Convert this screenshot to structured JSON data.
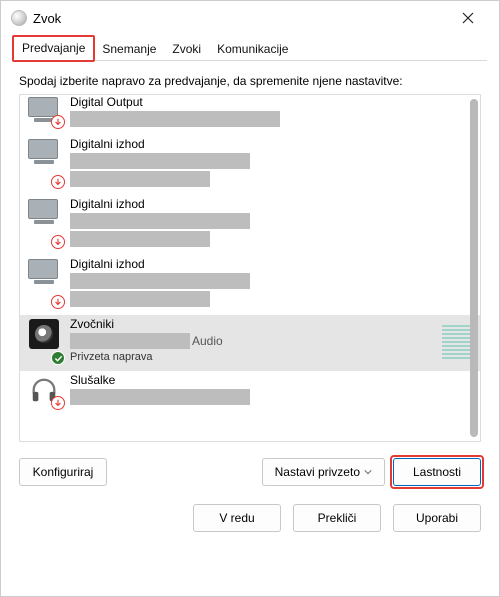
{
  "window": {
    "title": "Zvok"
  },
  "tabs": [
    {
      "label": "Predvajanje",
      "active": true
    },
    {
      "label": "Snemanje",
      "active": false
    },
    {
      "label": "Zvoki",
      "active": false
    },
    {
      "label": "Komunikacije",
      "active": false
    }
  ],
  "instruction": "Spodaj izberite napravo za predvajanje, da spremenite njene nastavitve:",
  "devices": [
    {
      "name": "Digital Output",
      "icon": "monitor",
      "status_badge": "down",
      "truncated_top": true
    },
    {
      "name": "Digitalni izhod",
      "icon": "monitor",
      "status_badge": "down"
    },
    {
      "name": "Digitalni izhod",
      "icon": "monitor",
      "status_badge": "down"
    },
    {
      "name": "Digitalni izhod",
      "icon": "monitor",
      "status_badge": "down"
    },
    {
      "name": "Zvočniki",
      "icon": "speaker",
      "status_badge": "ok",
      "desc_suffix": "Audio",
      "status_text": "Privzeta naprava",
      "selected": true,
      "meter": true
    },
    {
      "name": "Slušalke",
      "icon": "headphones",
      "status_badge": "down",
      "truncated_bottom": true
    }
  ],
  "buttons": {
    "configure": "Konfiguriraj",
    "set_default": "Nastavi privzeto",
    "properties": "Lastnosti"
  },
  "footer": {
    "ok": "V redu",
    "cancel": "Prekliči",
    "apply": "Uporabi"
  }
}
